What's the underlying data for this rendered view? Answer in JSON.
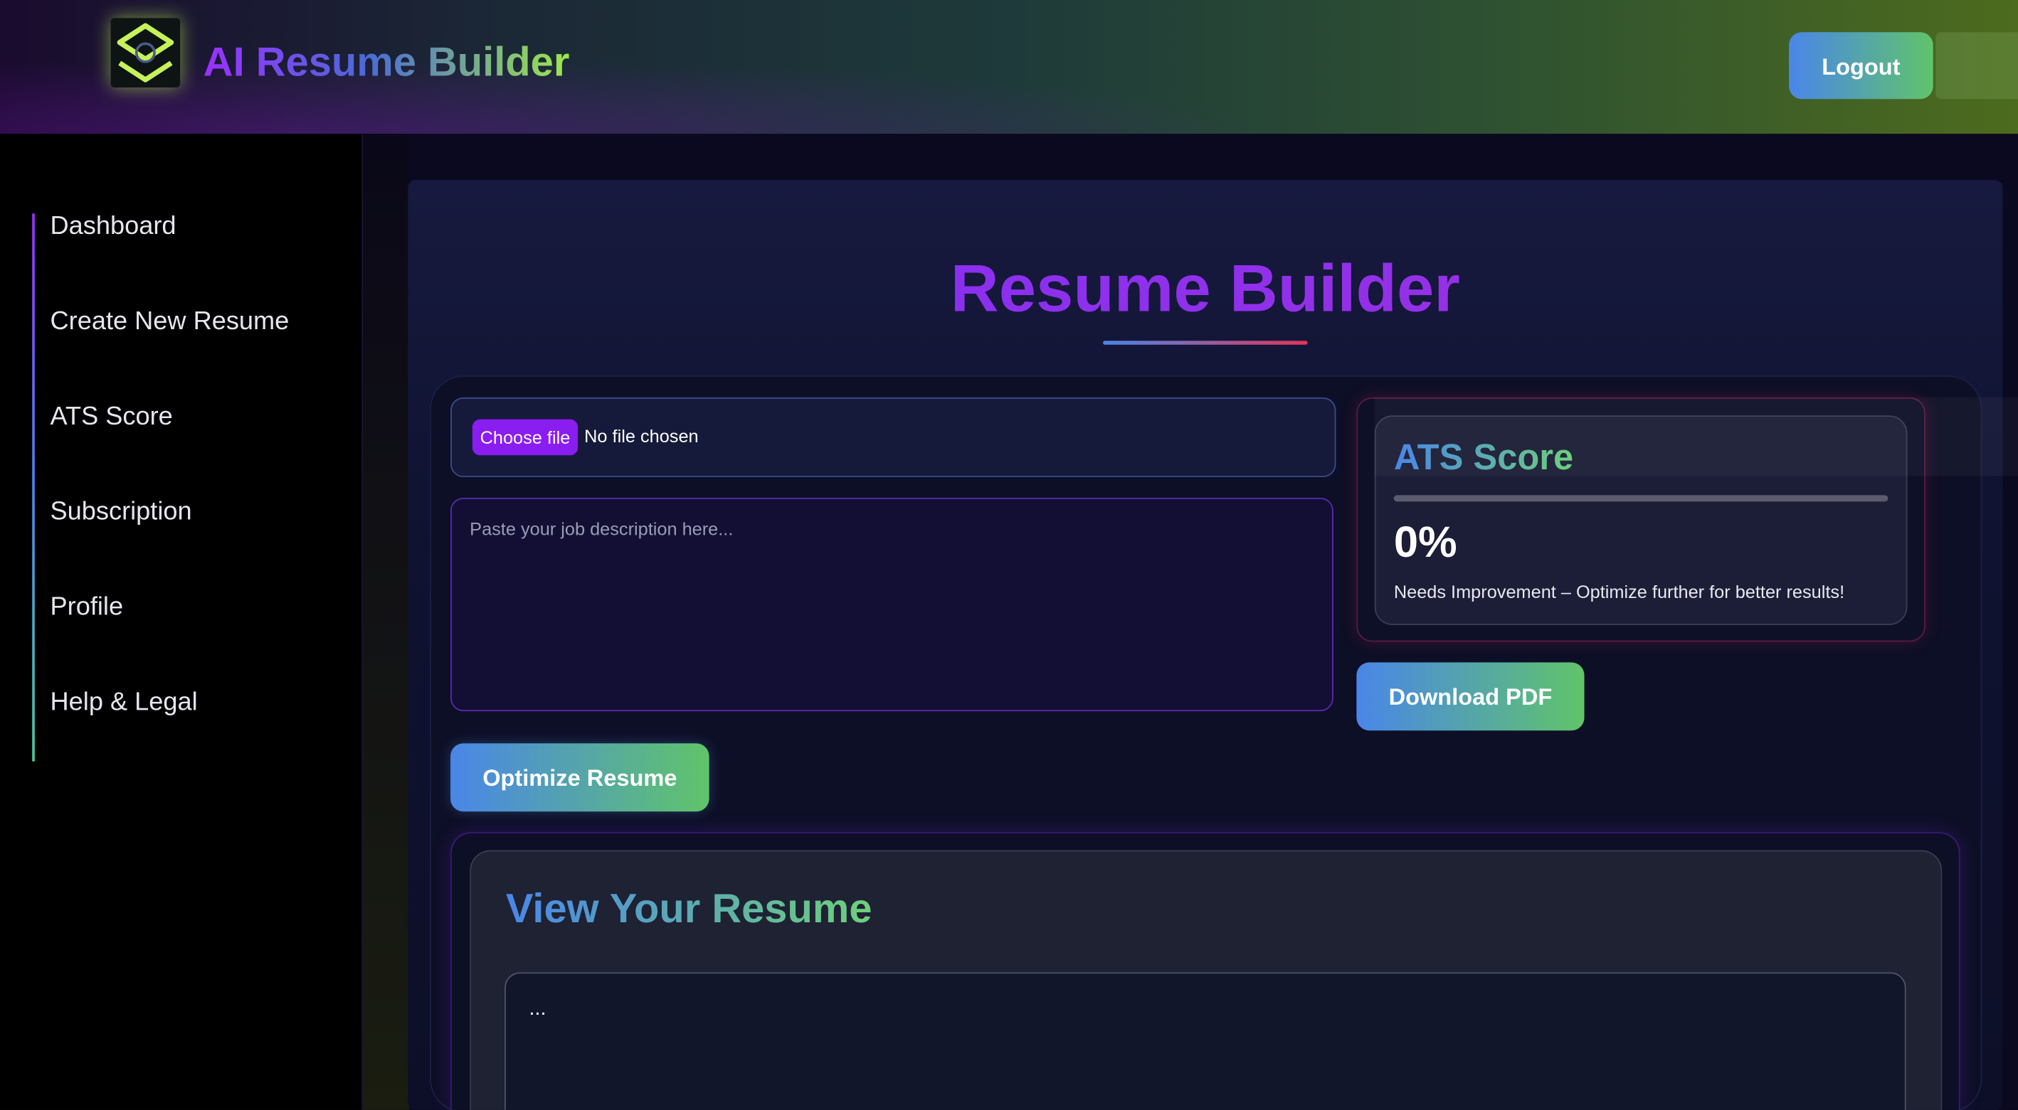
{
  "header": {
    "app_title": "AI Resume Builder",
    "logo_icon": "layers-logo-icon",
    "logout_label": "Logout"
  },
  "sidebar": {
    "items": [
      {
        "label": "Dashboard"
      },
      {
        "label": "Create New Resume"
      },
      {
        "label": "ATS Score"
      },
      {
        "label": "Subscription"
      },
      {
        "label": "Profile"
      },
      {
        "label": "Help & Legal"
      }
    ]
  },
  "main": {
    "page_title": "Resume Builder",
    "upload": {
      "button_label": "Choose file",
      "status": "No file chosen"
    },
    "job_description": {
      "placeholder": "Paste your job description here...",
      "value": ""
    },
    "optimize_label": "Optimize Resume",
    "ats": {
      "title": "ATS Score",
      "score_text": "0%",
      "score_fraction": 0,
      "message": "Needs Improvement – Optimize further for better results!"
    },
    "download_label": "Download PDF",
    "view": {
      "title": "View Your Resume",
      "preview_text": "..."
    }
  },
  "colors": {
    "accent_purple": "#8a1df0",
    "accent_blue": "#4a86e8",
    "accent_green": "#60c46a",
    "logo_lime": "#c6f25a"
  }
}
